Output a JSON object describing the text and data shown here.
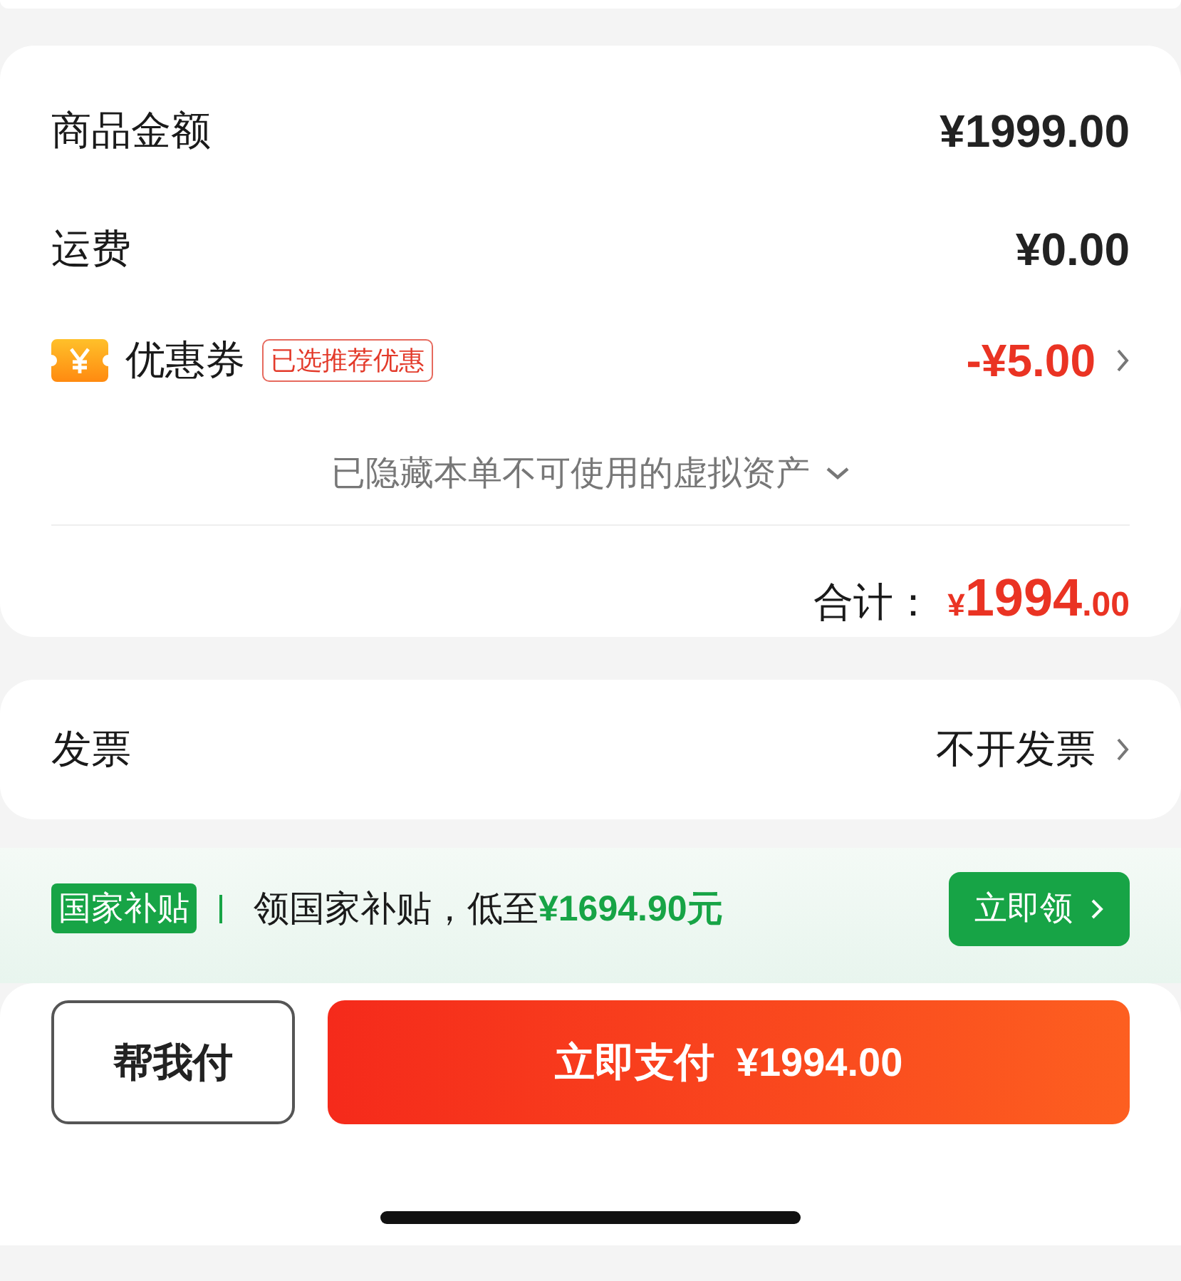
{
  "summary": {
    "rows": [
      {
        "kind": "amount",
        "label": "商品金额",
        "value": "¥1999.00"
      },
      {
        "kind": "amount",
        "label": "运费",
        "value": "¥0.00"
      },
      {
        "kind": "coupon",
        "label": "优惠券",
        "tag": "已选推荐优惠",
        "value": "-¥5.00"
      }
    ],
    "hidden_assets": "已隐藏本单不可使用的虚拟资产",
    "total": {
      "label": "合计：",
      "currency": "¥",
      "integer": "1994",
      "decimal": ".00"
    }
  },
  "invoice": {
    "label": "发票",
    "value": "不开发票"
  },
  "subsidy": {
    "badge": "国家补贴",
    "text": "领国家补贴，低至**¥1694.90元**",
    "button": "立即领"
  },
  "actions": [
    {
      "kind": "secondary",
      "label": "帮我付"
    },
    {
      "kind": "primary",
      "label": "立即支付  ¥1994.00"
    }
  ]
}
